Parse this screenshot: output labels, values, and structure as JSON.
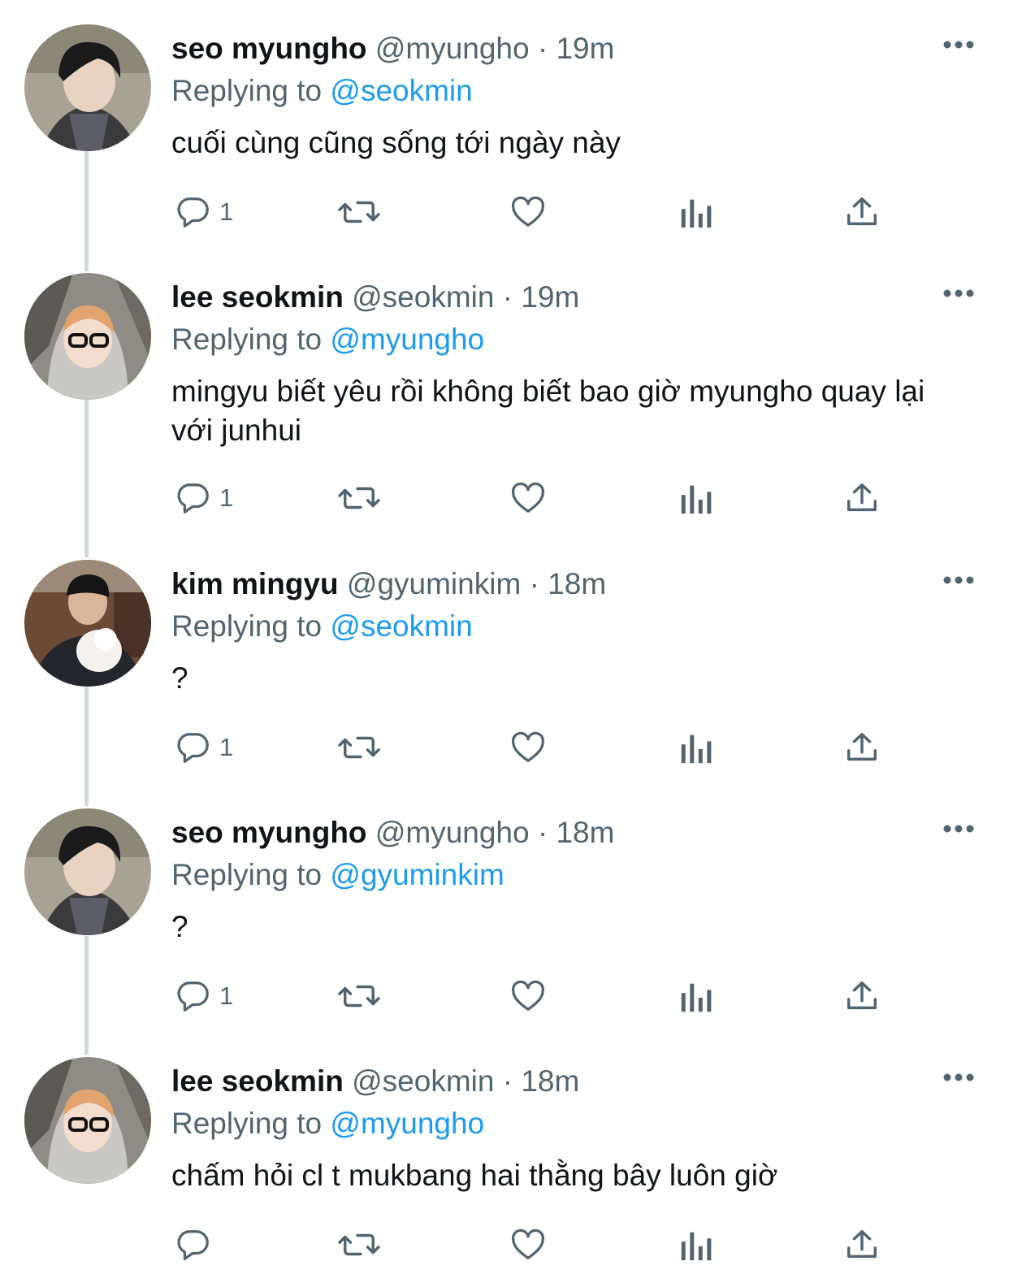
{
  "colors": {
    "text": "#0f1419",
    "secondary": "#536471",
    "accent": "#1d9bf0",
    "thread_line": "#cfd9de"
  },
  "icons": {
    "reply": "speech-bubble-icon",
    "retweet": "retweet-arrows-icon",
    "like": "heart-icon",
    "views": "bar-chart-icon",
    "share": "share-upload-icon",
    "more": "more-dots-icon"
  },
  "tweets": [
    {
      "name": "seo myungho",
      "handle": "@myungho",
      "dot": "·",
      "time": "19m",
      "replying_label": "Replying to",
      "replying_to": "@seokmin",
      "text": "cuối cùng cũng sống tới ngày này",
      "reply_count": "1",
      "avatar": "avatar-myungho"
    },
    {
      "name": "lee seokmin",
      "handle": "@seokmin",
      "dot": "·",
      "time": "19m",
      "replying_label": "Replying to",
      "replying_to": "@myungho",
      "text": "mingyu biết yêu rồi không biết bao giờ myungho quay lại với junhui",
      "reply_count": "1",
      "avatar": "avatar-seokmin"
    },
    {
      "name": "kim mingyu",
      "handle": "@gyuminkim",
      "dot": "·",
      "time": "18m",
      "replying_label": "Replying to",
      "replying_to": "@seokmin",
      "text": "?",
      "reply_count": "1",
      "avatar": "avatar-mingyu"
    },
    {
      "name": "seo myungho",
      "handle": "@myungho",
      "dot": "·",
      "time": "18m",
      "replying_label": "Replying to",
      "replying_to": "@gyuminkim",
      "text": "?",
      "reply_count": "1",
      "avatar": "avatar-myungho"
    },
    {
      "name": "lee seokmin",
      "handle": "@seokmin",
      "dot": "·",
      "time": "18m",
      "replying_label": "Replying to",
      "replying_to": "@myungho",
      "text": "chấm hỏi cl t mukbang hai thằng bây luôn giờ",
      "reply_count": "",
      "avatar": "avatar-seokmin"
    }
  ]
}
